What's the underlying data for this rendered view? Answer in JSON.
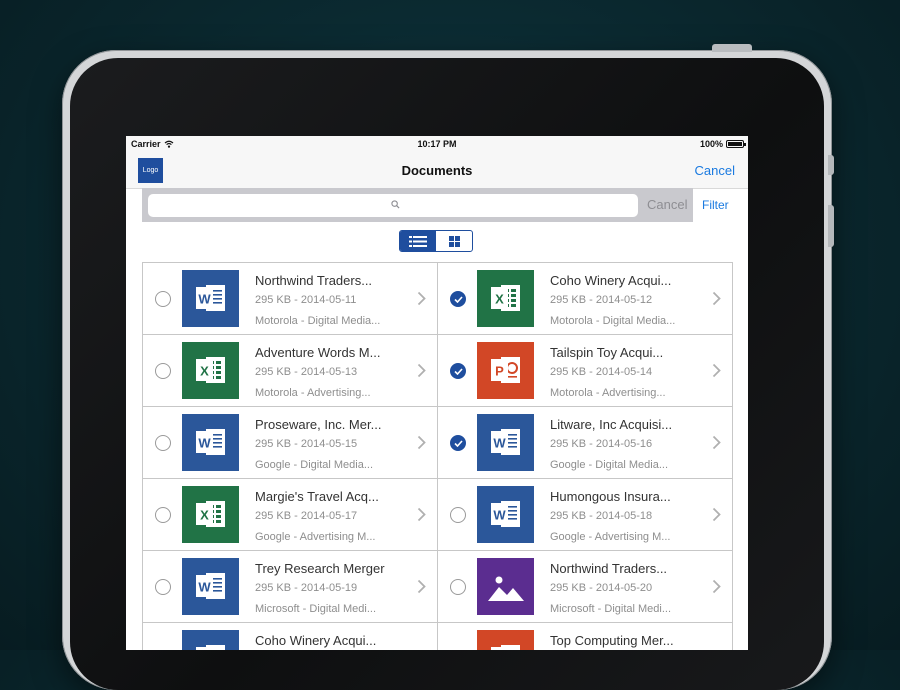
{
  "status": {
    "carrier": "Carrier",
    "time": "10:17 PM",
    "battery": "100%"
  },
  "nav": {
    "logo": "Logo",
    "title": "Documents",
    "cancel": "Cancel"
  },
  "search": {
    "placeholder": "",
    "cancel": "Cancel",
    "filter": "Filter"
  },
  "view_toggle": {
    "active": "list",
    "options": [
      "list-view-icon",
      "grid-view-icon"
    ]
  },
  "colors": {
    "accent": "#1a7ae0",
    "brand": "#1f4e9e",
    "word": "#2b579a",
    "excel": "#217346",
    "powerpoint": "#d24726",
    "image": "#5b2d90"
  },
  "documents": [
    {
      "name": "Northwind Traders...",
      "meta": "295 KB - 2014-05-11",
      "owner": "Motorola - Digital Media...",
      "type": "word",
      "selected": false
    },
    {
      "name": "Coho Winery Acqui...",
      "meta": "295 KB - 2014-05-12",
      "owner": "Motorola - Digital Media...",
      "type": "excel",
      "selected": true
    },
    {
      "name": "Adventure Words M...",
      "meta": "295 KB - 2014-05-13",
      "owner": "Motorola - Advertising...",
      "type": "excel",
      "selected": false
    },
    {
      "name": "Tailspin Toy Acqui...",
      "meta": "295 KB - 2014-05-14",
      "owner": "Motorola - Advertising...",
      "type": "ppt",
      "selected": true
    },
    {
      "name": "Proseware, Inc. Mer...",
      "meta": "295 KB - 2014-05-15",
      "owner": "Google - Digital Media...",
      "type": "word",
      "selected": false
    },
    {
      "name": "Litware, Inc Acquisi...",
      "meta": "295 KB - 2014-05-16",
      "owner": "Google - Digital Media...",
      "type": "word",
      "selected": true
    },
    {
      "name": "Margie's Travel Acq...",
      "meta": "295 KB - 2014-05-17",
      "owner": "Google - Advertising M...",
      "type": "excel",
      "selected": false
    },
    {
      "name": "Humongous Insura...",
      "meta": "295 KB - 2014-05-18",
      "owner": "Google - Advertising M...",
      "type": "word",
      "selected": false
    },
    {
      "name": "Trey Research Merger",
      "meta": "295 KB - 2014-05-19",
      "owner": "Microsoft - Digital Medi...",
      "type": "word",
      "selected": false
    },
    {
      "name": "Northwind Traders...",
      "meta": "295 KB - 2014-05-20",
      "owner": "Microsoft - Digital Medi...",
      "type": "image",
      "selected": false
    },
    {
      "name": "Coho Winery Acqui...",
      "meta": "",
      "owner": "",
      "type": "word",
      "selected": false
    },
    {
      "name": "Top Computing Mer...",
      "meta": "",
      "owner": "",
      "type": "ppt",
      "selected": false
    }
  ]
}
